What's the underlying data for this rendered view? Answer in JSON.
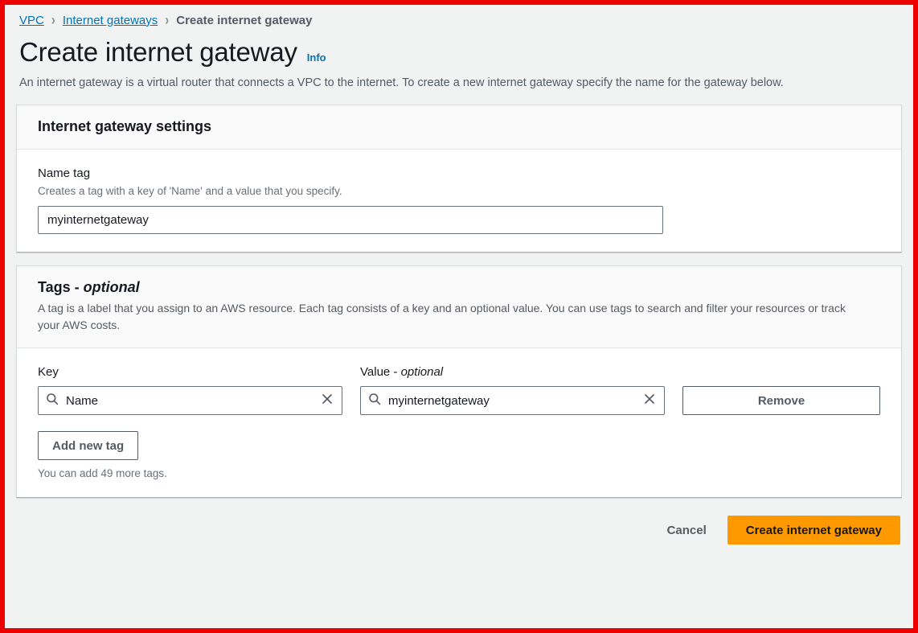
{
  "breadcrumb": {
    "items": [
      {
        "label": "VPC",
        "link": true
      },
      {
        "label": "Internet gateways",
        "link": true
      },
      {
        "label": "Create internet gateway",
        "link": false
      }
    ],
    "separator": "›"
  },
  "header": {
    "title": "Create internet gateway",
    "info_label": "Info",
    "description": "An internet gateway is a virtual router that connects a VPC to the internet. To create a new internet gateway specify the name for the gateway below."
  },
  "settings_card": {
    "title": "Internet gateway settings",
    "name_tag": {
      "label": "Name tag",
      "hint": "Creates a tag with a key of 'Name' and a value that you specify.",
      "value": "myinternetgateway",
      "placeholder": ""
    }
  },
  "tags_card": {
    "title_main": "Tags - ",
    "title_optional": "optional",
    "description": "A tag is a label that you assign to an AWS resource. Each tag consists of a key and an optional value. You can use tags to search and filter your resources or track your AWS costs.",
    "columns": {
      "key_label": "Key",
      "value_label_main": "Value - ",
      "value_label_optional": "optional"
    },
    "rows": [
      {
        "key": "Name",
        "value": "myinternetgateway",
        "remove_label": "Remove"
      }
    ],
    "add_tag_label": "Add new tag",
    "tag_count_text": "You can add 49 more tags."
  },
  "footer": {
    "cancel_label": "Cancel",
    "submit_label": "Create internet gateway"
  },
  "colors": {
    "accent_link": "#0073BB",
    "primary_button": "#FF9900",
    "highlight_frame": "#EE0000",
    "page_background": "#F1F3F3",
    "text_primary": "#16191F",
    "text_secondary": "#545B64"
  },
  "icons": {
    "search": "search-icon",
    "clear": "close-icon",
    "chevron": "chevron-right-icon"
  }
}
